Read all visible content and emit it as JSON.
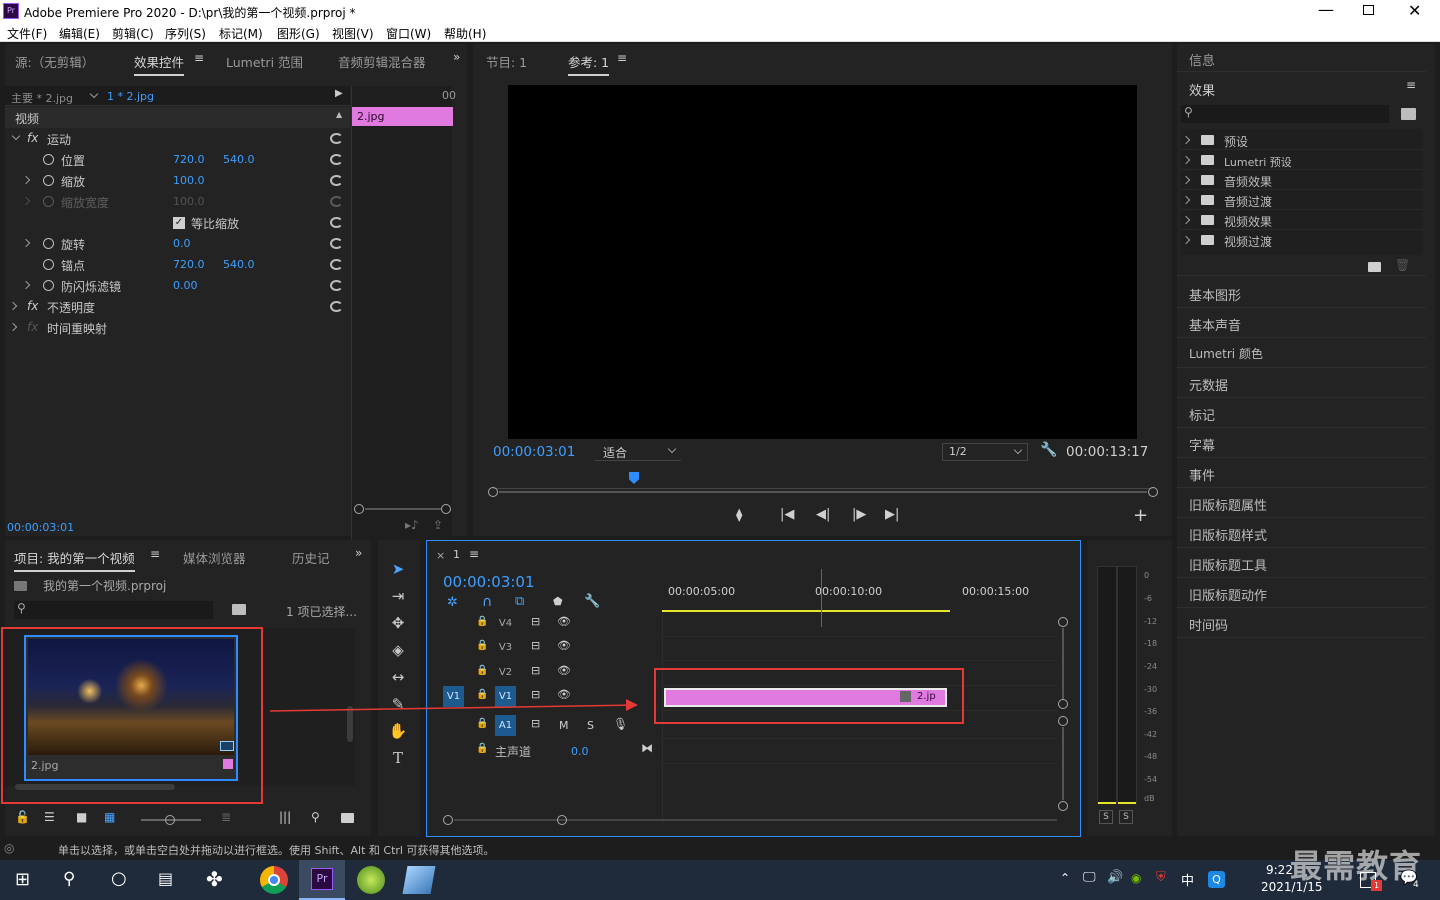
{
  "app": {
    "title": "Adobe Premiere Pro 2020 - D:\\pr\\我的第一个视频.prproj *"
  },
  "menu": [
    "文件(F)",
    "编辑(E)",
    "剪辑(C)",
    "序列(S)",
    "标记(M)",
    "图形(G)",
    "视图(V)",
    "窗口(W)",
    "帮助(H)"
  ],
  "source_panel": {
    "tabs": [
      "源:（无剪辑）",
      "效果控件",
      "Lumetri 范围",
      "音频剪辑混合器"
    ],
    "active_tab": "效果控件",
    "clip_master": "主要 * 2.jpg",
    "clip_seq": "1 * 2.jpg",
    "clip_bar_label": "2.jpg",
    "ruler_label": "00",
    "section_video": "视频",
    "effects": [
      {
        "name": "运动"
      },
      {
        "name": "位置",
        "v1": "720.0",
        "v2": "540.0"
      },
      {
        "name": "缩放",
        "v1": "100.0"
      },
      {
        "name": "缩放宽度",
        "v1": "100.0"
      },
      {
        "name": "等比缩放"
      },
      {
        "name": "旋转",
        "v1": "0.0"
      },
      {
        "name": "锚点",
        "v1": "720.0",
        "v2": "540.0"
      },
      {
        "name": "防闪烁滤镜",
        "v1": "0.00"
      },
      {
        "name": "不透明度"
      },
      {
        "name": "时间重映射"
      }
    ],
    "fx": "fx",
    "timecode": "00:00:03:01"
  },
  "program_panel": {
    "tabs": [
      "节目: 1",
      "参考: 1"
    ],
    "active_tab": "参考: 1",
    "timecode": "00:00:03:01",
    "fit": "适合",
    "resolution": "1/2",
    "duration": "00:00:13:17"
  },
  "project_panel": {
    "tabs": [
      "项目: 我的第一个视频",
      "媒体浏览器",
      "历史记"
    ],
    "project_file": "我的第一个视频.prproj",
    "selection": "1 项已选择...",
    "clip_name": "2.jpg"
  },
  "timeline": {
    "tab": "1",
    "timecode": "00:00:03:01",
    "ruler": [
      "00:00:05:00",
      "00:00:10:00",
      "00:00:15:00"
    ],
    "tracks_video": [
      "V4",
      "V3",
      "V2",
      "V1"
    ],
    "src_v1": "V1",
    "track_a1": "A1",
    "mute": "M",
    "solo": "S",
    "master": "主声道",
    "master_val": "0.0",
    "clip_label": "2.jp"
  },
  "meter": {
    "scale": [
      "0",
      "-6",
      "-12",
      "-18",
      "-24",
      "-30",
      "-36",
      "-42",
      "-48",
      "-54",
      "dB"
    ],
    "solo": "S"
  },
  "right_panel": {
    "info": "信息",
    "effects_title": "效果",
    "effect_tree": [
      "预设",
      "Lumetri 预设",
      "音频效果",
      "音频过渡",
      "视频效果",
      "视频过渡"
    ],
    "items": [
      "基本图形",
      "基本声音",
      "Lumetri 颜色",
      "元数据",
      "标记",
      "字幕",
      "事件",
      "旧版标题属性",
      "旧版标题样式",
      "旧版标题工具",
      "旧版标题动作",
      "时间码"
    ]
  },
  "status": "单击以选择，或单击空白处并拖动以进行框选。使用 Shift、Alt 和 Ctrl 可获得其他选项。",
  "taskbar": {
    "time": "9:22",
    "date": "2021/1/15",
    "ime": "中",
    "watermark": "最需教育",
    "notif_count": "1",
    "badge": "4"
  },
  "colors": {
    "accent_blue": "#3e9fff",
    "clip_pink": "#e07ae0",
    "highlight_red": "#e53935",
    "timeline_yellow": "#e5e52a"
  }
}
